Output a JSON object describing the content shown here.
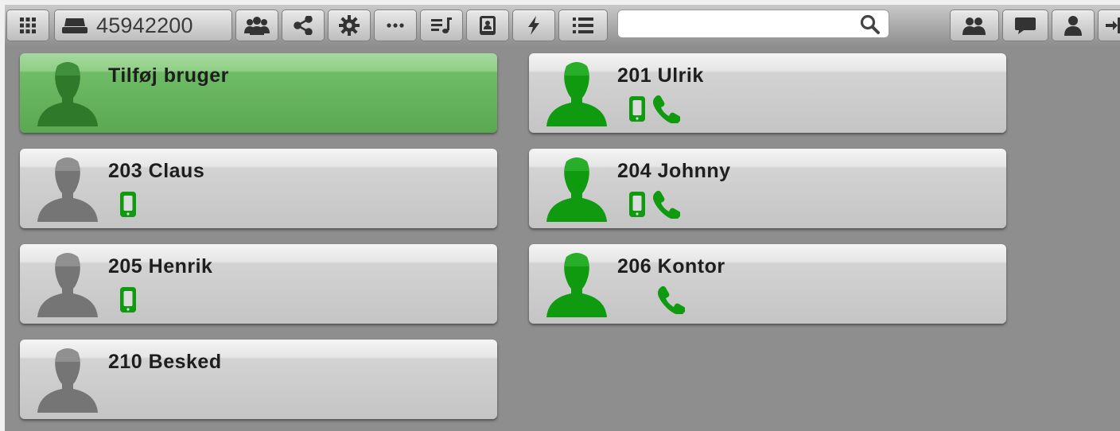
{
  "toolbar": {
    "phone_number": "45942200",
    "search": {
      "value": "",
      "placeholder": ""
    }
  },
  "colors": {
    "accent_green": "#0f9a10",
    "inactive_gray": "#757575",
    "add_card_green": "#6fbc66"
  },
  "users": [
    {
      "name": "Tilføj bruger",
      "type": "add",
      "status": "gray",
      "mobile": false,
      "phone": false
    },
    {
      "name": "201 Ulrik",
      "type": "user",
      "status": "online",
      "mobile": true,
      "phone": true
    },
    {
      "name": "203 Claus",
      "type": "user",
      "status": "offline",
      "mobile": true,
      "phone": false
    },
    {
      "name": "204 Johnny",
      "type": "user",
      "status": "online",
      "mobile": true,
      "phone": true
    },
    {
      "name": "205 Henrik",
      "type": "user",
      "status": "offline",
      "mobile": true,
      "phone": false
    },
    {
      "name": "206 Kontor",
      "type": "user",
      "status": "online",
      "mobile": false,
      "phone": true
    },
    {
      "name": "210 Besked",
      "type": "user",
      "status": "offline",
      "mobile": false,
      "phone": false
    }
  ]
}
